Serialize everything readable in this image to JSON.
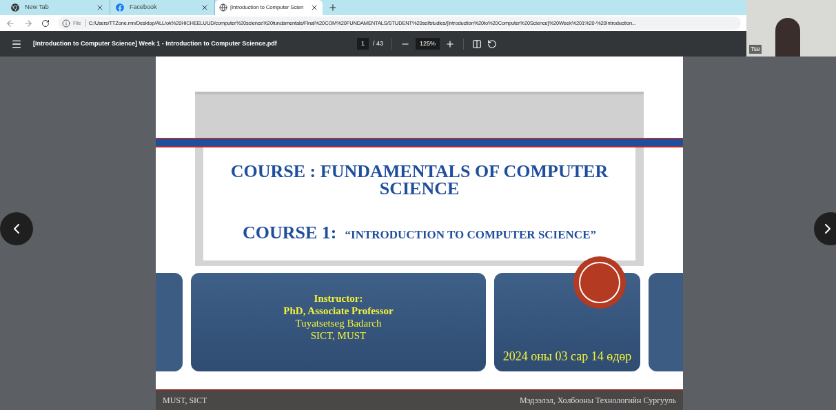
{
  "tabs": [
    {
      "label": "New Tab",
      "kind": "chrome",
      "selected": false
    },
    {
      "label": "Facebook",
      "kind": "facebook",
      "selected": false
    },
    {
      "label": "[Introduction to Computer Scien",
      "kind": "web",
      "selected": true
    }
  ],
  "address_bar": {
    "scheme": "File",
    "url": "C:/Users/TTZone.mn/Desktop/ALL/ok%20HICHEELUUD/computer%20science%20fundamentals/Final%20COM%20FUNDAMENTALS/STUDENT%20selfstudies/[Introduction%20to%20Computer%20Science]%20Week%201%20-%20Introduction..."
  },
  "pdf_toolbar": {
    "title": "[Introduction to Computer Science] Week 1 - Introduction to Computer Science.pdf",
    "page": "1",
    "page_total": "/ 43",
    "zoom": "125%"
  },
  "webcam": {
    "name": "Tse"
  },
  "slide": {
    "title": "COURSE : FUNDAMENTALS OF COMPUTER SCIENCE",
    "subtitle_label": "COURSE 1:",
    "subtitle": "“INTRODUCTION TO COMPUTER SCIENCE”",
    "instructor": [
      {
        "text": "Instructor:",
        "bold": true
      },
      {
        "text": "PhD, Associate Professor",
        "bold": true
      },
      {
        "text": "Tuyatsetseg Badarch",
        "bold": false
      },
      {
        "text": "SICT, MUST",
        "bold": false
      }
    ],
    "date": "2024 оны 03 сар 14 өдөр",
    "footer_left": "MUST, SICT",
    "footer_right": "Мэдээлэл, Холбооны Технологийн Сургууль"
  }
}
